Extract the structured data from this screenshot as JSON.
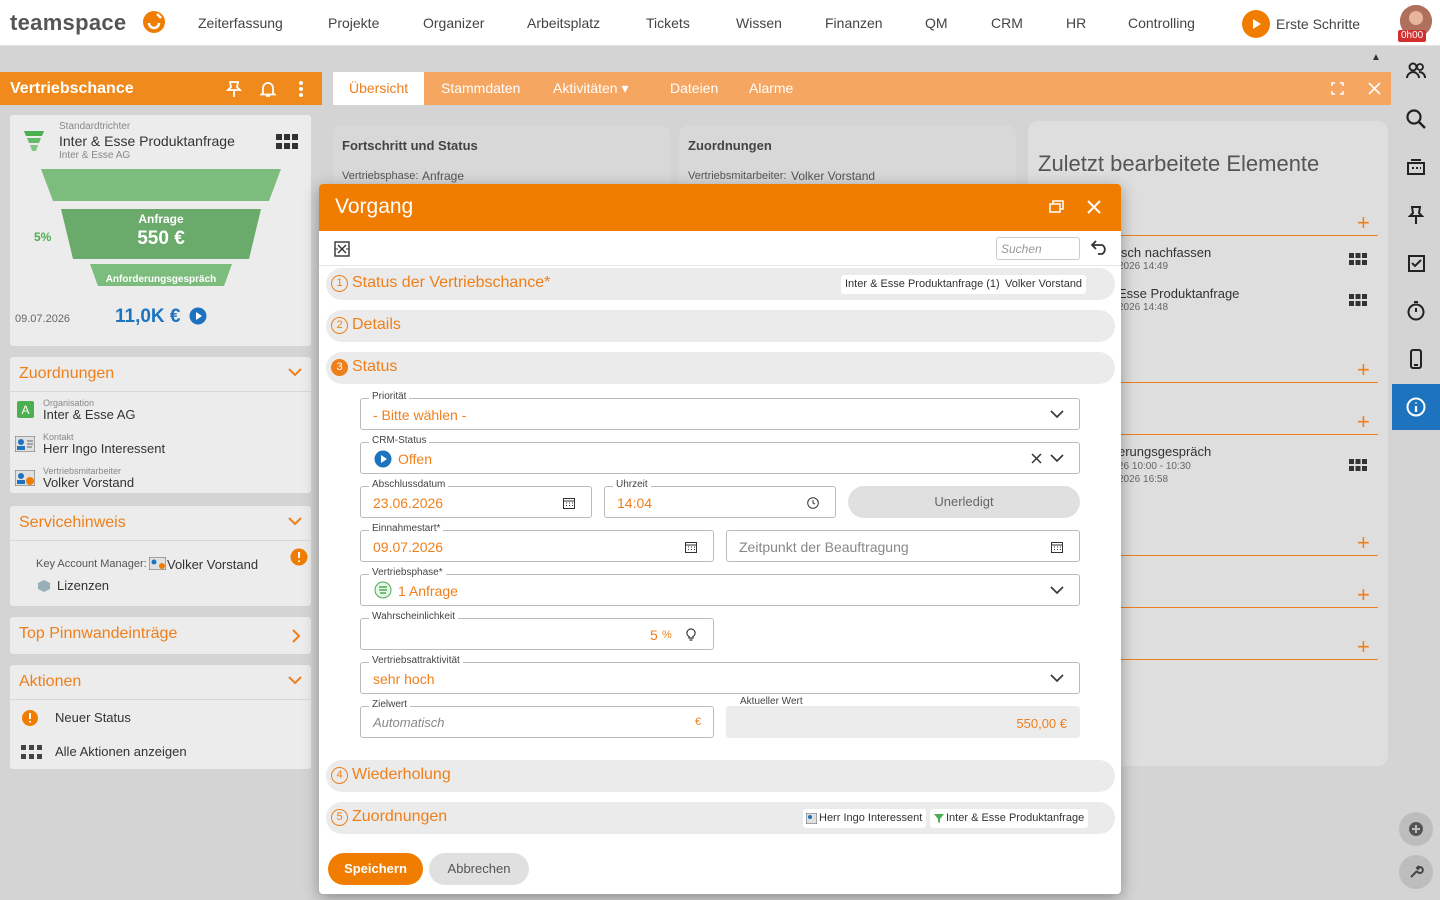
{
  "brand": {
    "name": "teamspace",
    "accent": "#f07d00",
    "active_blue": "#1e73be"
  },
  "nav": {
    "items": [
      "Zeiterfassung",
      "Projekte",
      "Organizer",
      "Arbeitsplatz",
      "Tickets",
      "Wissen",
      "Finanzen",
      "QM",
      "CRM",
      "HR",
      "Controlling"
    ],
    "start": "Erste Schritte",
    "timer_badge": "0h00"
  },
  "left": {
    "title": "Vertriebschance",
    "funnel": {
      "type_label": "Standardtrichter",
      "name": "Inter & Esse Produktanfrage",
      "company": "Inter & Esse AG",
      "stage": "Anfrage",
      "stage_value": "550 €",
      "next_stage": "Anforderungsgespräch",
      "probability": "5%",
      "date": "09.07.2026",
      "total": "11,0K €"
    },
    "assignments": {
      "title": "Zuordnungen",
      "items": [
        {
          "label": "Organisation",
          "value": "Inter & Esse AG"
        },
        {
          "label": "Kontakt",
          "value": "Herr Ingo Interessent"
        },
        {
          "label": "Vertriebsmitarbeiter",
          "value": "Volker Vorstand"
        }
      ]
    },
    "service": {
      "title": "Servicehinweis",
      "kam_label": "Key Account Manager:",
      "kam_value": "Volker Vorstand",
      "licenses": "Lizenzen"
    },
    "pinboard": {
      "title": "Top Pinnwandeinträge"
    },
    "actions": {
      "title": "Aktionen",
      "items": [
        "Neuer Status",
        "Alle Aktionen anzeigen"
      ]
    }
  },
  "tabs": [
    "Übersicht",
    "Stammdaten",
    "Aktivitäten ▾",
    "Dateien",
    "Alarme"
  ],
  "background": {
    "progress_title": "Fortschritt und Status",
    "progress_label": "Vertriebsphase:",
    "progress_value": "Anfrage",
    "assign_title": "Zuordnungen",
    "assign_label": "Vertriebsmitarbeiter:",
    "assign_value": "Volker Vorstand",
    "recent_title": "Zuletzt bearbeitete Elemente",
    "recent_items": [
      {
        "text": "isch nachfassen",
        "sub": "2026 14:49"
      },
      {
        "text": "Esse Produktanfrage",
        "sub": "2026 14:48"
      },
      {
        "text": "erungsgespräch",
        "sub": "26 10:00 - 10:30",
        "sub2": "2026 16:58"
      }
    ]
  },
  "modal": {
    "title": "Vorgang",
    "search_placeholder": "Suchen",
    "sections": [
      {
        "num": "1",
        "label": "Status der Vertriebschance*",
        "chips": [
          "Inter & Esse Produktanfrage (1)",
          "Volker Vorstand"
        ]
      },
      {
        "num": "2",
        "label": "Details"
      },
      {
        "num": "3",
        "label": "Status"
      },
      {
        "num": "4",
        "label": "Wiederholung"
      },
      {
        "num": "5",
        "label": "Zuordnungen",
        "chips": [
          "Herr Ingo Interessent",
          "Inter & Esse Produktanfrage"
        ]
      }
    ],
    "fields": {
      "priority": {
        "label": "Priorität",
        "value": "- Bitte wählen -"
      },
      "crm_status": {
        "label": "CRM-Status",
        "value": "Offen"
      },
      "close_date": {
        "label": "Abschlussdatum",
        "value": "23.06.2026"
      },
      "time": {
        "label": "Uhrzeit",
        "value": "14:04"
      },
      "undone": "Unerledigt",
      "revenue_start": {
        "label": "Einnahmestart*",
        "value": "09.07.2026"
      },
      "commission": {
        "placeholder": "Zeitpunkt der Beauftragung"
      },
      "phase": {
        "label": "Vertriebsphase*",
        "value": "1 Anfrage"
      },
      "probability": {
        "label": "Wahrscheinlichkeit",
        "value": "5",
        "unit": "%"
      },
      "attractiveness": {
        "label": "Vertriebsattraktivität",
        "value": "sehr hoch"
      },
      "target": {
        "label": "Zielwert",
        "placeholder": "Automatisch",
        "unit": "€"
      },
      "current": {
        "label": "Aktueller Wert",
        "value": "550,00 €"
      }
    },
    "save": "Speichern",
    "cancel": "Abbrechen"
  }
}
